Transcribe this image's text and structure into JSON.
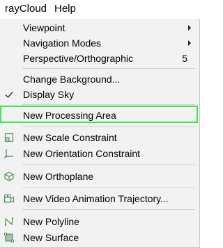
{
  "menubar": {
    "items": [
      "rayCloud",
      "Help"
    ]
  },
  "menu": {
    "viewpoint": "Viewpoint",
    "navigation_modes": "Navigation Modes",
    "perspective": "Perspective/Orthographic",
    "perspective_shortcut": "5",
    "change_background": "Change Background...",
    "display_sky": "Display Sky",
    "new_processing_area": "New Processing Area",
    "new_scale_constraint": "New Scale Constraint",
    "new_orientation_constraint": "New Orientation Constraint",
    "new_orthoplane": "New Orthoplane",
    "new_video_trajectory": "New Video Animation Trajectory...",
    "new_polyline": "New Polyline",
    "new_surface": "New Surface"
  },
  "state": {
    "display_sky_checked": true,
    "highlighted_item": "New Processing Area"
  },
  "icons": {
    "check": "checkmark-icon",
    "scale_constraint": "scale-constraint-icon",
    "orientation_constraint": "orientation-constraint-icon",
    "orthoplane": "orthoplane-icon",
    "video_trajectory": "video-camera-icon",
    "polyline": "polyline-icon",
    "surface": "surface-icon"
  },
  "colors": {
    "menu_bg": "#f2f2f2",
    "highlight_border": "#44e05a",
    "icon_green": "#4f8a55",
    "separator": "#d3d3d3"
  }
}
